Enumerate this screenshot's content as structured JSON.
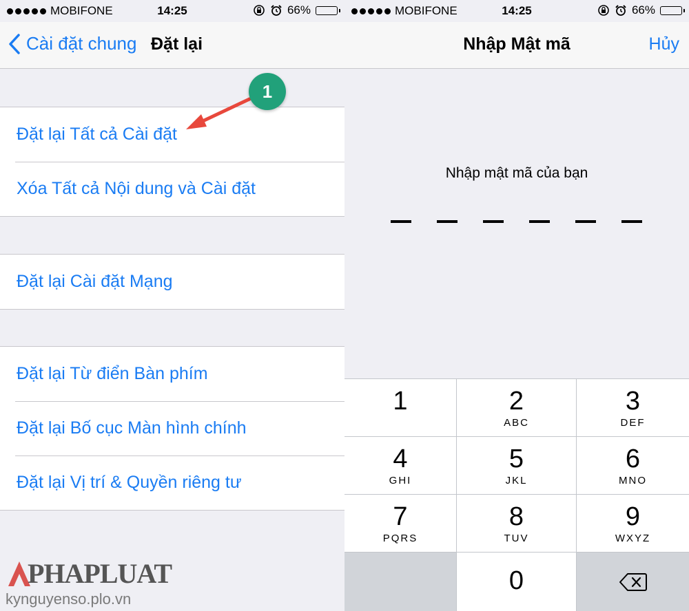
{
  "left": {
    "status": {
      "carrier": "MOBIFONE",
      "time": "14:25",
      "battery": "66%"
    },
    "nav": {
      "back_label": "Cài đặt chung",
      "title": "Đặt lại"
    },
    "groups": [
      [
        "Đặt lại Tất cả Cài đặt",
        "Xóa Tất cả Nội dung và Cài đặt"
      ],
      [
        "Đặt lại Cài đặt Mạng"
      ],
      [
        "Đặt lại Từ điển Bàn phím",
        "Đặt lại Bố cục Màn hình chính",
        "Đặt lại Vị trí & Quyền riêng tư"
      ]
    ],
    "badge": "1"
  },
  "right": {
    "status": {
      "carrier": "MOBIFONE",
      "time": "14:25",
      "battery": "66%"
    },
    "nav": {
      "title": "Nhập Mật mã",
      "cancel_label": "Hủy"
    },
    "prompt": "Nhập mật mã của bạn",
    "passcode_length": 6,
    "keys": [
      {
        "num": "1",
        "letters": ""
      },
      {
        "num": "2",
        "letters": "ABC"
      },
      {
        "num": "3",
        "letters": "DEF"
      },
      {
        "num": "4",
        "letters": "GHI"
      },
      {
        "num": "5",
        "letters": "JKL"
      },
      {
        "num": "6",
        "letters": "MNO"
      },
      {
        "num": "7",
        "letters": "PQRS"
      },
      {
        "num": "8",
        "letters": "TUV"
      },
      {
        "num": "9",
        "letters": "WXYZ"
      },
      {
        "num": "0",
        "letters": ""
      }
    ]
  },
  "watermark": {
    "brand": "PHAPLUAT",
    "site": "kynguyenso.plo.vn"
  },
  "colors": {
    "ios_blue": "#1a7cf3",
    "badge_green": "#21a17a",
    "arrow_red": "#e8483c",
    "background": "#efeff4"
  }
}
